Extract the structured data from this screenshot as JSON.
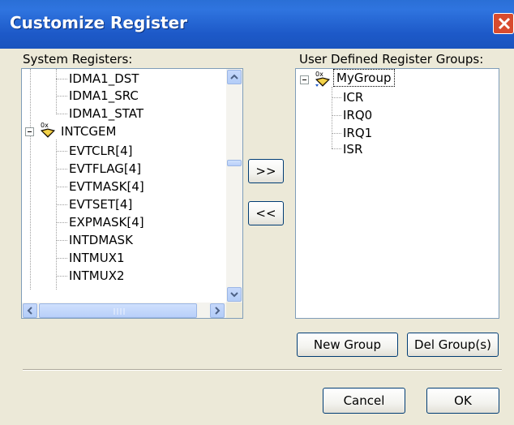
{
  "window": {
    "title": "Customize Register"
  },
  "system_registers": {
    "label": "System Registers:",
    "items": [
      {
        "text": "IDMA1_DST",
        "kind": "leaf"
      },
      {
        "text": "IDMA1_SRC",
        "kind": "leaf"
      },
      {
        "text": "IDMA1_STAT",
        "kind": "leaf"
      },
      {
        "text": "INTCGEM",
        "kind": "group",
        "expanded": true
      },
      {
        "text": "EVTCLR[4]",
        "kind": "leaf"
      },
      {
        "text": "EVTFLAG[4]",
        "kind": "leaf"
      },
      {
        "text": "EVTMASK[4]",
        "kind": "leaf"
      },
      {
        "text": "EVTSET[4]",
        "kind": "leaf"
      },
      {
        "text": "EXPMASK[4]",
        "kind": "leaf"
      },
      {
        "text": "INTDMASK",
        "kind": "leaf"
      },
      {
        "text": "INTMUX1",
        "kind": "leaf"
      },
      {
        "text": "INTMUX2",
        "kind": "leaf"
      }
    ]
  },
  "user_groups": {
    "label": "User Defined Register Groups:",
    "group": {
      "text": "MyGroup",
      "expanded": true,
      "selected": true
    },
    "items": [
      "ICR",
      "IRQ0",
      "IRQ1",
      "ISR"
    ]
  },
  "buttons": {
    "add": ">>",
    "remove": "<<",
    "new_group": "New Group",
    "del_group": "Del Group(s)",
    "cancel": "Cancel",
    "ok": "OK"
  }
}
